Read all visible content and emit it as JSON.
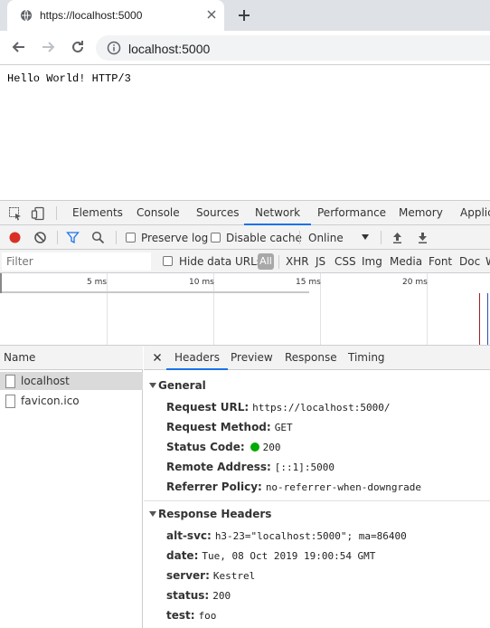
{
  "browser": {
    "tab_title": "https://localhost:5000",
    "url": "localhost:5000"
  },
  "page": {
    "text": "Hello World! HTTP/3"
  },
  "devtools": {
    "tabs": [
      "Elements",
      "Console",
      "Sources",
      "Network",
      "Performance",
      "Memory",
      "Applic"
    ],
    "active_tab": "Network",
    "toolbar": {
      "preserve_log": "Preserve log",
      "disable_cache": "Disable cache",
      "throttle": "Online"
    },
    "filter": {
      "placeholder": "Filter",
      "hide_data_urls": "Hide data URLs",
      "all": "All",
      "types": [
        "XHR",
        "JS",
        "CSS",
        "Img",
        "Media",
        "Font",
        "Doc",
        "W"
      ]
    },
    "overview_ticks": [
      "5 ms",
      "10 ms",
      "15 ms",
      "20 ms"
    ],
    "name_header": "Name",
    "requests": [
      "localhost",
      "favicon.ico"
    ],
    "detail_tabs": [
      "Headers",
      "Preview",
      "Response",
      "Timing"
    ],
    "general": {
      "title": "General",
      "rows": [
        {
          "key": "Request URL:",
          "value": "https://localhost:5000/"
        },
        {
          "key": "Request Method:",
          "value": "GET"
        },
        {
          "key": "Status Code:",
          "value": "200"
        },
        {
          "key": "Remote Address:",
          "value": "[::1]:5000"
        },
        {
          "key": "Referrer Policy:",
          "value": "no-referrer-when-downgrade"
        }
      ]
    },
    "response_headers": {
      "title": "Response Headers",
      "rows": [
        {
          "key": "alt-svc:",
          "value": "h3-23=\"localhost:5000\"; ma=86400"
        },
        {
          "key": "date:",
          "value": "Tue, 08 Oct 2019 19:00:54 GMT"
        },
        {
          "key": "server:",
          "value": "Kestrel"
        },
        {
          "key": "status:",
          "value": "200"
        },
        {
          "key": "test:",
          "value": "foo"
        }
      ]
    },
    "colors": {
      "record_red": "#d93025",
      "accent_blue": "#1a73e8",
      "status_green": "#00aa00"
    }
  }
}
